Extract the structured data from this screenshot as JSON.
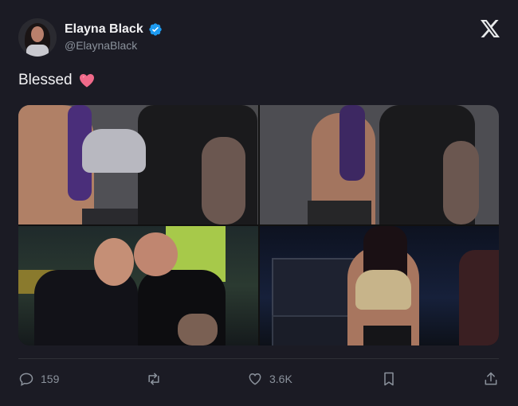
{
  "author": {
    "name": "Elayna Black",
    "handle": "@ElaynaBlack",
    "verified": true
  },
  "tweet": {
    "text": "Blessed",
    "emoji": "heart-emoji"
  },
  "media": {
    "count": 4
  },
  "metrics": {
    "replies": "159",
    "reposts": "",
    "likes": "3.6K"
  },
  "colors": {
    "background": "#1b1b24",
    "verified_blue": "#1d9bf0",
    "heart": "#f06a8a",
    "muted": "#8b929c"
  }
}
